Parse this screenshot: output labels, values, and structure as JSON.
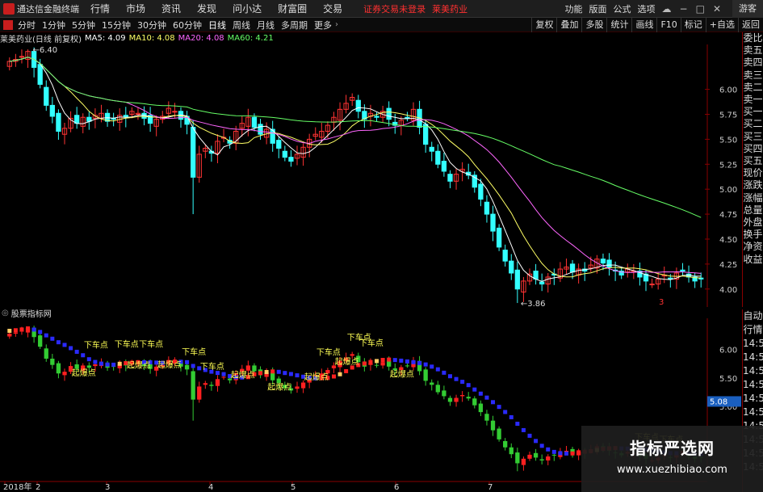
{
  "app": {
    "title": "通达信金融终端"
  },
  "menu": [
    "行情",
    "市场",
    "资讯",
    "发现",
    "问小达",
    "财富圈",
    "交易"
  ],
  "notice": {
    "text": "证券交易未登录",
    "stock": "莱美药业"
  },
  "right_menu": [
    "功能",
    "版面",
    "公式",
    "选项"
  ],
  "guest": "游客",
  "periods": [
    "分时",
    "1分钟",
    "5分钟",
    "15分钟",
    "30分钟",
    "60分钟",
    "日线",
    "周线",
    "月线",
    "多周期",
    "更多"
  ],
  "toolbar_buttons": [
    "复权",
    "叠加",
    "多股",
    "统计",
    "画线",
    "F10",
    "标记",
    "+自选",
    "返回"
  ],
  "legend": {
    "name": "莱美药业(日线 前复权)",
    "ma5": "MA5: 4.09",
    "ma10": "MA10: 4.08",
    "ma20": "MA20: 4.08",
    "ma60": "MA60: 4.21"
  },
  "sidebar": [
    "委比",
    "卖五",
    "卖四",
    "卖三",
    "卖二",
    "卖一",
    "买一",
    "买二",
    "买三",
    "买四",
    "买五",
    "现价",
    "涨跌",
    "涨幅",
    "总量",
    "外盘",
    "换手",
    "净资",
    "收益"
  ],
  "sub_title": "股票指标网",
  "sub_side": [
    "自动",
    "行情",
    "14:50",
    "14:50",
    "14:50",
    "14:50",
    "14:50",
    "14:50",
    "14:50",
    "14:50",
    "14:50",
    "14:50"
  ],
  "x_labels": [
    "2018年",
    "2",
    "3",
    "4",
    "5",
    "6",
    "7"
  ],
  "watermark": {
    "line1": "指标严选网",
    "line2": "www.xuezhibiao.com"
  },
  "colors": {
    "up": "#ff3333",
    "down": "#33ffff",
    "ma5": "#ffffff",
    "ma10": "#ffff66",
    "ma20": "#ff66ff",
    "ma60": "#66ff66",
    "sub_up": "#ff2020",
    "sub_down": "#2a2aff",
    "sub_mid": "#ffcc66",
    "sub_green": "#33cc33"
  },
  "chart_data": {
    "type": "candlestick",
    "series": [
      {
        "name": "MA5",
        "values": [
          4.09
        ]
      },
      {
        "name": "MA10",
        "values": [
          4.08
        ]
      },
      {
        "name": "MA20",
        "values": [
          4.08
        ]
      },
      {
        "name": "MA60",
        "values": [
          4.21
        ]
      }
    ],
    "y_ticks": [
      "6.00",
      "5.75",
      "5.50",
      "5.25",
      "5.00",
      "4.75",
      "4.50",
      "4.25",
      "4.00"
    ],
    "annotations": [
      {
        "text": "6.40"
      },
      {
        "text": "3.86"
      },
      {
        "text": "3"
      }
    ],
    "sub_y_ticks": [
      "6.00",
      "5.50",
      "5.00"
    ],
    "sub_current": "5.08",
    "sub_labels": [
      "下车点",
      "起爆点",
      "下车点",
      "下车点",
      "下车点",
      "起爆点",
      "起爆点",
      "下车点",
      "下车点",
      "起爆点",
      "起爆点",
      "起爆点",
      "下车点",
      "下车点",
      "起爆点",
      "下车点",
      "起爆点",
      "下车点",
      "下车点"
    ],
    "x_labels": [
      "2018年",
      "2",
      "3",
      "4",
      "5",
      "6",
      "7"
    ],
    "close": [
      6.28,
      6.3,
      6.33,
      6.38,
      6.22,
      6.05,
      5.84,
      5.73,
      5.58,
      5.61,
      5.71,
      5.66,
      5.72,
      5.68,
      5.74,
      5.76,
      5.68,
      5.7,
      5.74,
      5.72,
      5.78,
      5.76,
      5.71,
      5.66,
      5.7,
      5.73,
      5.81,
      5.78,
      5.7,
      5.65,
      5.12,
      5.35,
      5.41,
      5.36,
      5.48,
      5.52,
      5.46,
      5.58,
      5.66,
      5.72,
      5.62,
      5.55,
      5.6,
      5.46,
      5.41,
      5.32,
      5.28,
      5.35,
      5.42,
      5.5,
      5.55,
      5.58,
      5.64,
      5.72,
      5.8,
      5.86,
      5.92,
      5.78,
      5.7,
      5.76,
      5.72,
      5.78,
      5.7,
      5.64,
      5.69,
      5.72,
      5.8,
      5.62,
      5.45,
      5.38,
      5.25,
      5.18,
      5.08,
      5.15,
      5.2,
      5.14,
      5.02,
      4.9,
      4.75,
      4.58,
      4.42,
      4.28,
      4.16,
      4.0,
      4.08,
      4.15,
      4.1,
      4.05,
      4.12,
      4.14,
      4.2,
      4.22,
      4.17,
      4.2,
      4.18,
      4.24,
      4.3,
      4.26,
      4.22,
      4.18,
      4.14,
      4.2,
      4.18,
      4.12,
      4.08,
      4.05,
      4.1,
      4.14,
      4.1,
      4.16,
      4.18,
      4.12,
      4.08,
      4.1
    ]
  }
}
